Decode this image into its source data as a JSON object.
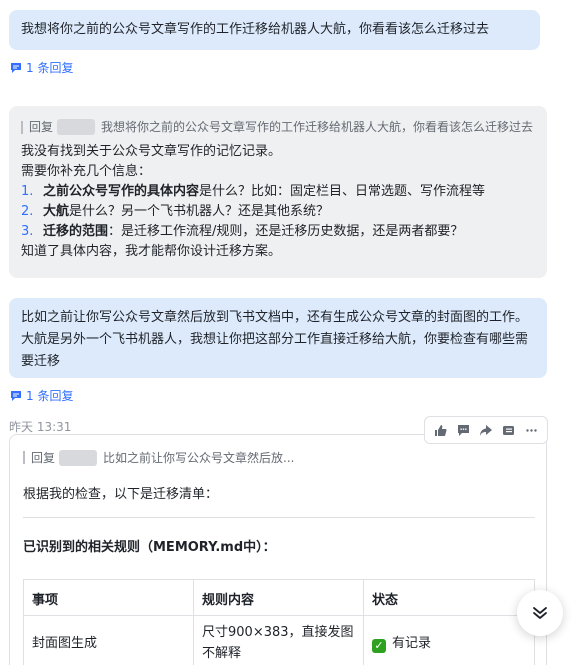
{
  "messages": {
    "m1": {
      "text": "我想将你之前的公众号文章写作的工作迁移给机器人大航，你看看该怎么迁移过去"
    },
    "reply_count_1": "1 条回复",
    "m2": {
      "quote_prefix": "回复",
      "quote_text": "我想将你之前的公众号文章写作的工作迁移给机器人大航，你看看该怎么迁移过去",
      "line1": "我没有找到关于公众号文章写作的记忆记录。",
      "line2": "需要你补充几个信息：",
      "items": [
        {
          "num": "1.",
          "bold": "之前公众号写作的具体内容",
          "rest": "是什么？比如：固定栏目、日常选题、写作流程等"
        },
        {
          "num": "2.",
          "bold": "大航",
          "rest": "是什么？另一个飞书机器人？还是其他系统？"
        },
        {
          "num": "3.",
          "bold": "迁移的范围",
          "rest": "：是迁移工作流程/规则，还是迁移历史数据，还是两者都要？"
        }
      ],
      "closing": "知道了具体内容，我才能帮你设计迁移方案。"
    },
    "m3": {
      "text": "比如之前让你写公众号文章然后放到飞书文档中，还有生成公众号文章的封面图的工作。大航是另外一个飞书机器人，我想让你把这部分工作直接迁移给大航，你要检查有哪些需要迁移"
    },
    "reply_count_2": "1 条回复",
    "timestamp": "昨天 13:31",
    "m4": {
      "quote_prefix": "回复",
      "quote_text": "比如之前让你写公众号文章然后放...",
      "intro": "根据我的检查，以下是迁移清单：",
      "heading": "已识别到的相关规则（MEMORY.md中）：",
      "table": {
        "headers": [
          "事项",
          "规则内容",
          "状态"
        ],
        "rows": [
          {
            "item": "封面图生成",
            "rule": "尺寸900×383，直接发图不解释",
            "status": "有记录"
          }
        ]
      }
    }
  },
  "toolbar": [
    "thumbs-up-icon",
    "comment-icon",
    "forward-icon",
    "more-actions-icon",
    "ellipsis-icon"
  ],
  "colors": {
    "user_bubble": "#dceafc",
    "bot_bubble": "#eff0f1",
    "link": "#3370ff",
    "status_ok": "#2ea121"
  }
}
